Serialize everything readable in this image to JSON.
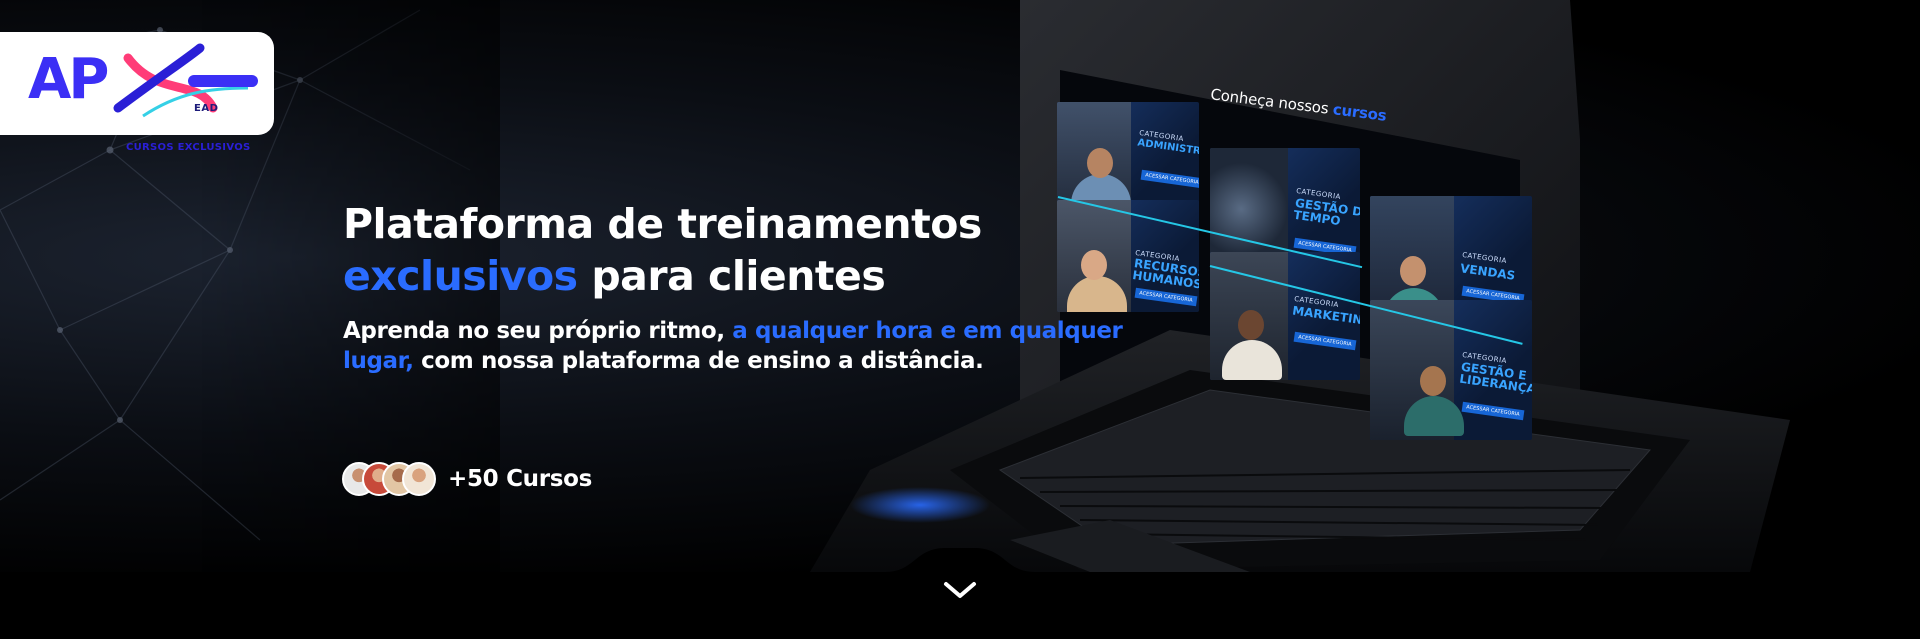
{
  "logo": {
    "mark": "AP",
    "suffix": "EAD",
    "tagline": "CURSOS EXCLUSIVOS"
  },
  "headline": {
    "line1": "Plataforma de treinamentos",
    "line2_accent": "exclusivos",
    "line2_rest": " para clientes"
  },
  "subheadline": {
    "part1": "Aprenda no seu próprio ritmo, ",
    "accent": "a qualquer hora e em qualquer lugar,",
    "part2": " com nossa plataforma de ensino a distância."
  },
  "courses_count": "+50 Cursos",
  "laptop_screen": {
    "title_prefix": "Conheça nossos ",
    "title_accent": "cursos",
    "category_label": "CATEGORIA",
    "button_label": "ACESSAR CATEGORIA",
    "cards": [
      {
        "name": "ADMINISTRAÇÃO"
      },
      {
        "name": "GESTÃO DE\nTEMPO"
      },
      {
        "name": "RECURSOS\nHUMANOS"
      },
      {
        "name": "VENDAS"
      },
      {
        "name": "MARKETING"
      },
      {
        "name": "GESTÃO E\nLIDERANÇA"
      }
    ]
  },
  "icons": {
    "scroll": "chevron-down-icon"
  },
  "colors": {
    "accent": "#2a6cff",
    "background": "#000000",
    "logo_blue": "#3b2ff5",
    "screen_line": "#25c7e6"
  }
}
